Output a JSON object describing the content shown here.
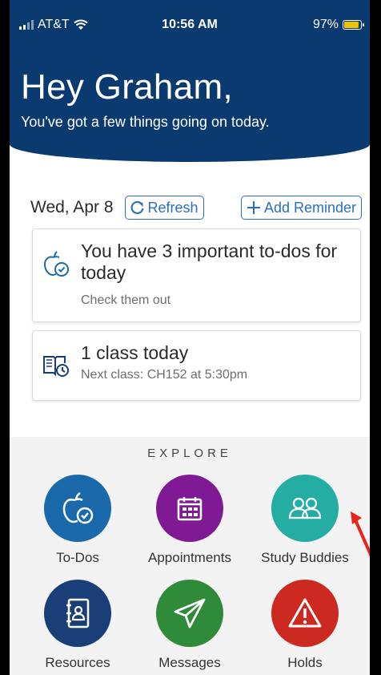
{
  "status_bar": {
    "carrier": "AT&T",
    "time": "10:56 AM",
    "battery": "97%"
  },
  "header": {
    "greeting": "Hey Graham,",
    "subtitle": "You've got a few things going on today."
  },
  "date_row": {
    "date": "Wed, Apr 8",
    "refresh_label": "Refresh",
    "add_reminder_label": "Add Reminder"
  },
  "cards": [
    {
      "icon": "apple-check-icon",
      "title": "You have 3 important to-dos for today",
      "note": "Check them out"
    },
    {
      "icon": "book-clock-icon",
      "title": "1 class today",
      "note": "Next class: CH152 at 5:30pm"
    }
  ],
  "explore": {
    "heading": "EXPLORE",
    "tiles": [
      {
        "label": "To-Dos",
        "icon": "apple-check-icon",
        "color": "#1a6aab"
      },
      {
        "label": "Appointments",
        "icon": "calendar-icon",
        "color": "#7f1a94"
      },
      {
        "label": "Study Buddies",
        "icon": "people-icon",
        "color": "#23ada3"
      },
      {
        "label": "Resources",
        "icon": "address-book-icon",
        "color": "#1a3f78"
      },
      {
        "label": "Messages",
        "icon": "paper-plane-icon",
        "color": "#2f8a3a"
      },
      {
        "label": "Holds",
        "icon": "warning-icon",
        "color": "#cc2a20"
      }
    ]
  },
  "colors": {
    "header_bg": "#0a3a70",
    "accent": "#2a6fc2",
    "annotation_arrow": "#e8231b"
  }
}
